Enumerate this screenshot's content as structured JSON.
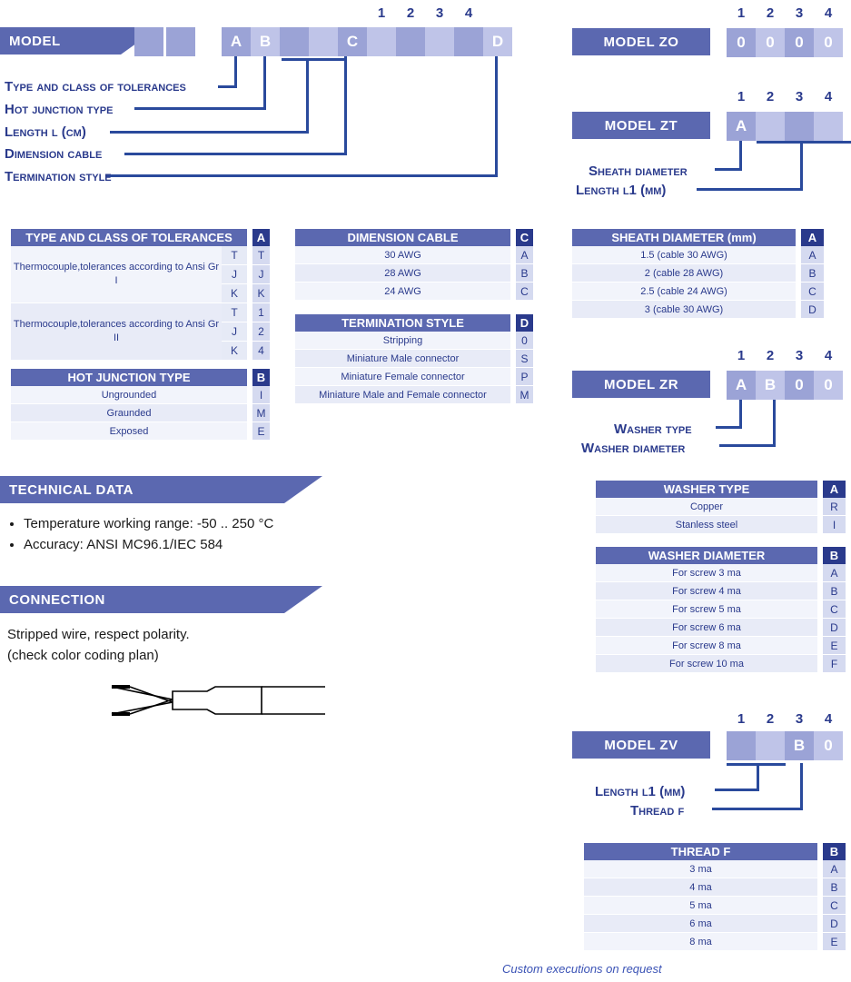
{
  "model_main": {
    "banner_label": "MODEL",
    "column_numbers": [
      "1",
      "2",
      "3",
      "4"
    ],
    "cells": [
      "",
      "",
      "A",
      "B",
      "",
      "",
      "C",
      "",
      "",
      "",
      "",
      "D"
    ],
    "callouts": [
      "Type and class of tolerances",
      "Hot junction type",
      "Length L (cm)",
      "Dimension cable",
      "Termination style"
    ]
  },
  "model_zo": {
    "banner_label": "MODEL ZO",
    "column_numbers": [
      "1",
      "2",
      "3",
      "4"
    ],
    "cells": [
      "0",
      "0",
      "0",
      "0"
    ]
  },
  "model_zt": {
    "banner_label": "MODEL ZT",
    "column_numbers": [
      "1",
      "2",
      "3",
      "4"
    ],
    "cells": [
      "A",
      "",
      "",
      ""
    ],
    "callouts": [
      "Sheath diameter",
      "Length L1 (mm)"
    ]
  },
  "model_zr": {
    "banner_label": "MODEL ZR",
    "column_numbers": [
      "1",
      "2",
      "3",
      "4"
    ],
    "cells": [
      "A",
      "B",
      "0",
      "0"
    ],
    "callouts": [
      "Washer type",
      "Washer diameter"
    ]
  },
  "model_zv": {
    "banner_label": "MODEL ZV",
    "column_numbers": [
      "1",
      "2",
      "3",
      "4"
    ],
    "cells": [
      "",
      "",
      "B",
      "0"
    ],
    "callouts": [
      "Length L1 (mm)",
      "Thread F"
    ]
  },
  "table_tolerances": {
    "header": "TYPE AND CLASS OF TOLERANCES",
    "header_code": "A",
    "groups": [
      {
        "description": "Thermocouple,tolerances according to Ansi Gr I",
        "types": [
          "T",
          "J",
          "K"
        ],
        "codes": [
          "T",
          "J",
          "K"
        ]
      },
      {
        "description": "Thermocouple,tolerances according to Ansi Gr II",
        "types": [
          "T",
          "J",
          "K"
        ],
        "codes": [
          "1",
          "2",
          "4"
        ]
      }
    ]
  },
  "table_hot_junction": {
    "header": "HOT JUNCTION TYPE",
    "header_code": "B",
    "rows": [
      {
        "label": "Ungrounded",
        "code": "I"
      },
      {
        "label": "Graunded",
        "code": "M"
      },
      {
        "label": "Exposed",
        "code": "E"
      }
    ]
  },
  "table_dimension_cable": {
    "header": "DIMENSION CABLE",
    "header_code": "C",
    "rows": [
      {
        "label": "30 AWG",
        "code": "A"
      },
      {
        "label": "28 AWG",
        "code": "B"
      },
      {
        "label": "24 AWG",
        "code": "C"
      }
    ]
  },
  "table_termination_style": {
    "header": "TERMINATION STYLE",
    "header_code": "D",
    "rows": [
      {
        "label": "Stripping",
        "code": "0"
      },
      {
        "label": "Miniature Male connector",
        "code": "S"
      },
      {
        "label": "Miniature Female connector",
        "code": "P"
      },
      {
        "label": "Miniature Male and Female connector",
        "code": "M"
      }
    ]
  },
  "table_sheath_diameter": {
    "header": "SHEATH DIAMETER (mm)",
    "header_code": "A",
    "rows": [
      {
        "label": "1.5 (cable 30 AWG)",
        "code": "A"
      },
      {
        "label": "2 (cable 28 AWG)",
        "code": "B"
      },
      {
        "label": "2.5 (cable 24 AWG)",
        "code": "C"
      },
      {
        "label": "3 (cable 30 AWG)",
        "code": "D"
      }
    ]
  },
  "table_washer_type": {
    "header": "WASHER TYPE",
    "header_code": "A",
    "rows": [
      {
        "label": "Copper",
        "code": "R"
      },
      {
        "label": "Stanless steel",
        "code": "I"
      }
    ]
  },
  "table_washer_diameter": {
    "header": "WASHER DIAMETER",
    "header_code": "B",
    "rows": [
      {
        "label": "For screw 3 ma",
        "code": "A"
      },
      {
        "label": "For screw 4 ma",
        "code": "B"
      },
      {
        "label": "For screw 5 ma",
        "code": "C"
      },
      {
        "label": "For screw 6 ma",
        "code": "D"
      },
      {
        "label": "For screw 8 ma",
        "code": "E"
      },
      {
        "label": "For screw 10 ma",
        "code": "F"
      }
    ]
  },
  "table_thread_f": {
    "header": "THREAD F",
    "header_code": "B",
    "rows": [
      {
        "label": "3 ma",
        "code": "A"
      },
      {
        "label": "4 ma",
        "code": "B"
      },
      {
        "label": "5 ma",
        "code": "C"
      },
      {
        "label": "6 ma",
        "code": "D"
      },
      {
        "label": "8 ma",
        "code": "E"
      }
    ]
  },
  "technical_data": {
    "banner_label": "TECHNICAL DATA",
    "items": [
      "Temperature working range: -50 .. 250 °C",
      "Accuracy: ANSI MC96.1/IEC 584"
    ]
  },
  "connection": {
    "banner_label": "CONNECTION",
    "line1": "Stripped wire, respect polarity.",
    "line2": "(check color coding plan)",
    "diagram_name": "stripped-wire-diagram"
  },
  "footer": {
    "text": "Custom executions on request"
  },
  "colors": {
    "banner": "#5b68b0",
    "cell_dark": "#9ba3d6",
    "cell_light": "#bfc4e8",
    "text_blue": "#2a3a8c",
    "line_blue": "#2a4a9c",
    "code_header": "#2a3a8c"
  }
}
